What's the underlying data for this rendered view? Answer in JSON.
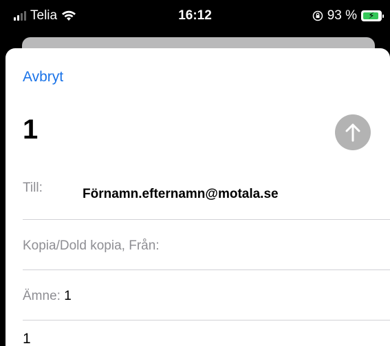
{
  "status_bar": {
    "carrier": "Telia",
    "time": "16:12",
    "battery_percent": "93 %",
    "battery_level": 0.93,
    "battery_color": "#35c759"
  },
  "icons": {
    "signal": "signal-strength-icon",
    "wifi": "wifi-icon",
    "orientation_lock": "orientation-lock-icon",
    "battery": "battery-charging-icon",
    "send": "arrow-up-icon"
  },
  "compose": {
    "cancel_label": "Avbryt",
    "title": "1",
    "to_label": "Till:",
    "to_value": "Förnamn.efternamn@motala.se",
    "cc_label": "Kopia/Dold kopia, Från:",
    "subject_label": "Ämne:",
    "subject_value": "1",
    "body": "1"
  },
  "colors": {
    "accent": "#1a73e8",
    "send_button_disabled": "#b3b3b3"
  }
}
